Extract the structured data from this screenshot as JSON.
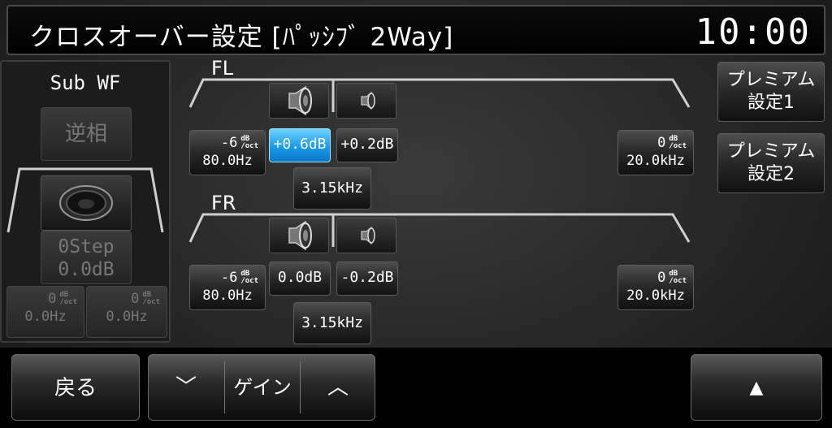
{
  "header": {
    "title": "クロスオーバー設定 [ﾊﾟｯｼﾌﾞ 2Way]",
    "clock": "10:00"
  },
  "unit": {
    "db": "dB",
    "oct": "/oct"
  },
  "subwf": {
    "title": "Sub WF",
    "reverse_label": "逆相",
    "step_label": "0Step",
    "gain": "0.0dB",
    "low": {
      "slope": "0",
      "freq": "0.0Hz"
    },
    "high": {
      "slope": "0",
      "freq": "0.0Hz"
    }
  },
  "fl": {
    "label": "FL",
    "hpf": {
      "slope": "-6",
      "freq": "80.0Hz"
    },
    "woofer_gain": "+0.6dB",
    "tweeter_gain": "+0.2dB",
    "crossover": "3.15kHz",
    "lpf": {
      "slope": "0",
      "freq": "20.0kHz"
    }
  },
  "fr": {
    "label": "FR",
    "hpf": {
      "slope": "-6",
      "freq": "80.0Hz"
    },
    "woofer_gain": "0.0dB",
    "tweeter_gain": "-0.2dB",
    "crossover": "3.15kHz",
    "lpf": {
      "slope": "0",
      "freq": "20.0kHz"
    }
  },
  "premium": {
    "preset1": {
      "line1": "プレミアム",
      "line2": "設定1"
    },
    "preset2": {
      "line1": "プレミアム",
      "line2": "設定2"
    }
  },
  "footer": {
    "back_label": "戻る",
    "gain_label": "ゲイン",
    "down_glyph": "﹀",
    "up_glyph": "︿",
    "scroll_up_glyph": "▲"
  },
  "colors": {
    "active": "#1a9ae8",
    "background": "#262626"
  }
}
